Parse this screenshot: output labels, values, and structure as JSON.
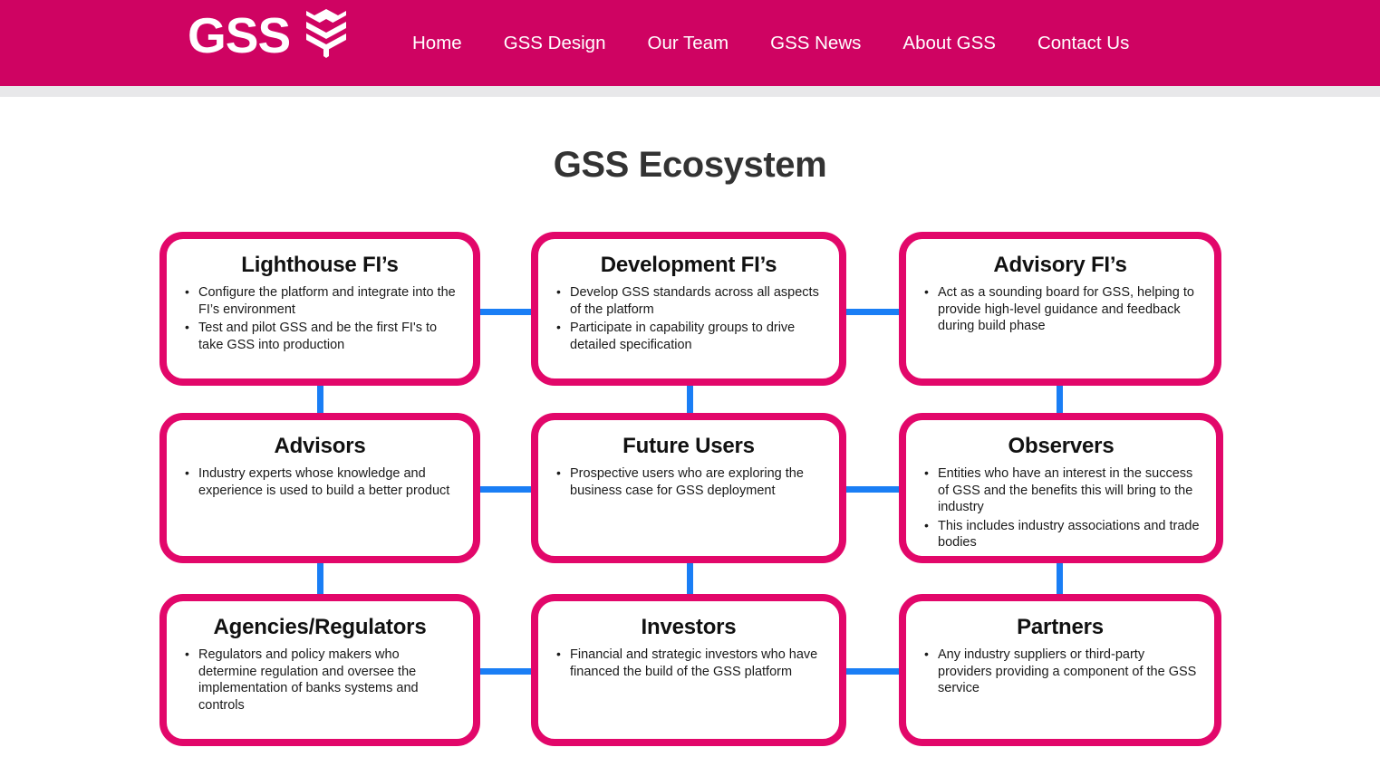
{
  "header": {
    "brand_text": "GSS",
    "brand_icon": "stacked-layers-logo-icon",
    "background_color": "#cf0362",
    "nav": [
      {
        "label": "Home"
      },
      {
        "label": "GSS Design"
      },
      {
        "label": "Our Team"
      },
      {
        "label": "GSS News"
      },
      {
        "label": "About GSS"
      },
      {
        "label": "Contact Us"
      }
    ]
  },
  "main": {
    "title": "GSS Ecosystem",
    "card_border_color": "#e2076a",
    "connector_color": "#1a7ef5",
    "cards": [
      {
        "id": "lighthouse-fis",
        "title": "Lighthouse FI’s",
        "bullets": [
          "Configure the platform and integrate into the FI’s environment",
          "Test and pilot GSS and be the first FI's to take GSS into production"
        ]
      },
      {
        "id": "development-fis",
        "title": "Development FI’s",
        "bullets": [
          "Develop GSS standards across all aspects of the platform",
          "Participate in capability groups to drive detailed specification"
        ]
      },
      {
        "id": "advisory-fis",
        "title": "Advisory FI’s",
        "bullets": [
          "Act as a sounding board for GSS, helping to provide high-level guidance and feedback during build phase"
        ]
      },
      {
        "id": "advisors",
        "title": "Advisors",
        "bullets": [
          "Industry experts whose knowledge and experience is used to build a better product"
        ]
      },
      {
        "id": "future-users",
        "title": "Future Users",
        "bullets": [
          "Prospective users who are exploring the business case for GSS deployment"
        ]
      },
      {
        "id": "observers",
        "title": "Observers",
        "bullets": [
          "Entities who have an interest in the success of GSS and the benefits this will bring to the industry",
          "This includes industry associations and trade bodies"
        ]
      },
      {
        "id": "agencies-regulators",
        "title": "Agencies/Regulators",
        "bullets": [
          "Regulators and policy makers who determine regulation and oversee the implementation of banks systems and controls"
        ]
      },
      {
        "id": "investors",
        "title": "Investors",
        "bullets": [
          "Financial and strategic investors who have financed the build of the GSS platform"
        ]
      },
      {
        "id": "partners",
        "title": "Partners",
        "bullets": [
          "Any industry suppliers or third-party providers providing a component of the GSS service"
        ]
      }
    ]
  }
}
